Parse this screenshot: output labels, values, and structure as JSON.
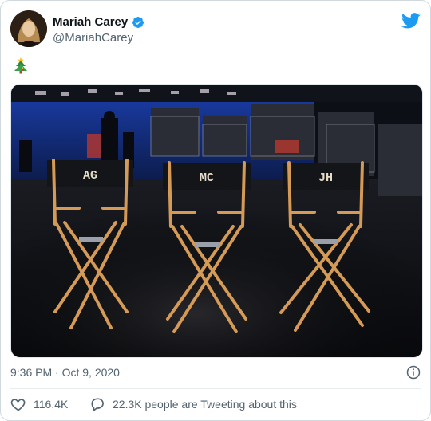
{
  "tweet": {
    "display_name": "Mariah Carey",
    "handle": "@MariahCarey",
    "emoji": "🎄",
    "timestamp": "9:36 PM · Oct 9, 2020",
    "likes": "116.4K",
    "conversation": "22.3K people are Tweeting about this"
  },
  "media": {
    "chairs": [
      {
        "label": "AG"
      },
      {
        "label": "MC"
      },
      {
        "label": "JH"
      }
    ]
  },
  "colors": {
    "accent": "#1d9bf0",
    "text_secondary": "#536471",
    "divider": "#e6ecf0"
  },
  "icons": [
    "verified-badge-icon",
    "twitter-bird-icon",
    "info-icon",
    "heart-icon",
    "reply-bubble-icon"
  ]
}
